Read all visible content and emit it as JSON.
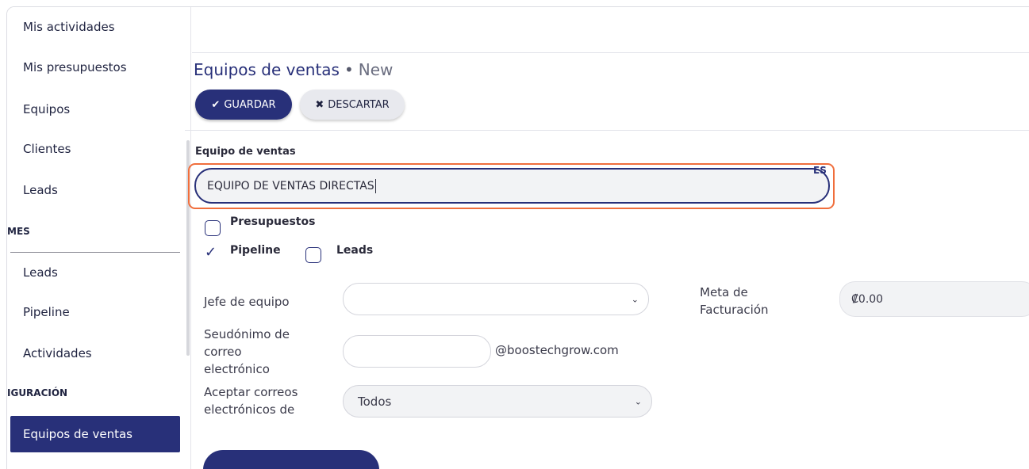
{
  "sidebar": {
    "items_top": [
      "Mis actividades",
      "Mis presupuestos",
      "Equipos",
      "Clientes",
      "Leads"
    ],
    "section_informes": "MES",
    "items_informes": [
      "Leads",
      "Pipeline",
      "Actividades"
    ],
    "section_config": "IGURACIÓN",
    "items_config": [
      "Equipos de ventas"
    ]
  },
  "page": {
    "title": "Equipos de ventas",
    "separator": "•",
    "state": "New"
  },
  "toolbar": {
    "save_label": "GUARDAR",
    "discard_label": "DESCARTAR"
  },
  "form": {
    "name_label": "Equipo de ventas",
    "name_value": "EQUIPO DE VENTAS DIRECTAS",
    "lang_tag": "ES",
    "presupuestos_label": "Presupuestos",
    "pipeline_label": "Pipeline",
    "leads_label": "Leads",
    "presupuestos_checked": false,
    "pipeline_checked": true,
    "leads_checked": false,
    "team_leader_label": "Jefe de equipo",
    "team_leader_value": "",
    "alias_label_1": "Seudónimo de",
    "alias_label_2": "correo",
    "alias_label_3": "electrónico",
    "alias_value": "",
    "alias_domain": "@boostechgrow.com",
    "accept_label_1": "Aceptar correos",
    "accept_label_2": "electrónicos de",
    "accept_value": "Todos",
    "invoicing_label_1": "Meta de",
    "invoicing_label_2": "Facturación",
    "invoicing_value": "₡0.00"
  },
  "colors": {
    "brand": "#283079",
    "highlight": "#f06e3c"
  }
}
